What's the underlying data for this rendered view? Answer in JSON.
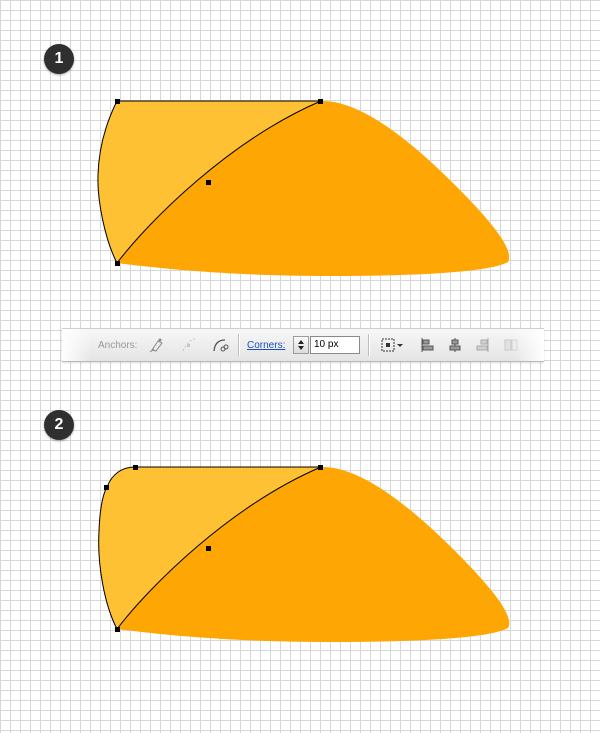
{
  "steps": [
    {
      "number": "1"
    },
    {
      "number": "2"
    }
  ],
  "toolbar": {
    "anchors_label": "Anchors:",
    "corners_label": "Corners:",
    "corners_value": "10 px",
    "icons": [
      "convert-anchor-smooth-icon",
      "convert-anchor-corner-icon",
      "cut-path-icon",
      "transform-reference-icon",
      "align-left-icon",
      "align-center-icon",
      "align-right-icon",
      "distribute-icon"
    ]
  },
  "colors": {
    "left_fill": "#FDC133",
    "right_fill": "#FEA603",
    "badge": "#2F2F2F",
    "grid": "#D7D7D7",
    "link": "#1A4FBF"
  }
}
